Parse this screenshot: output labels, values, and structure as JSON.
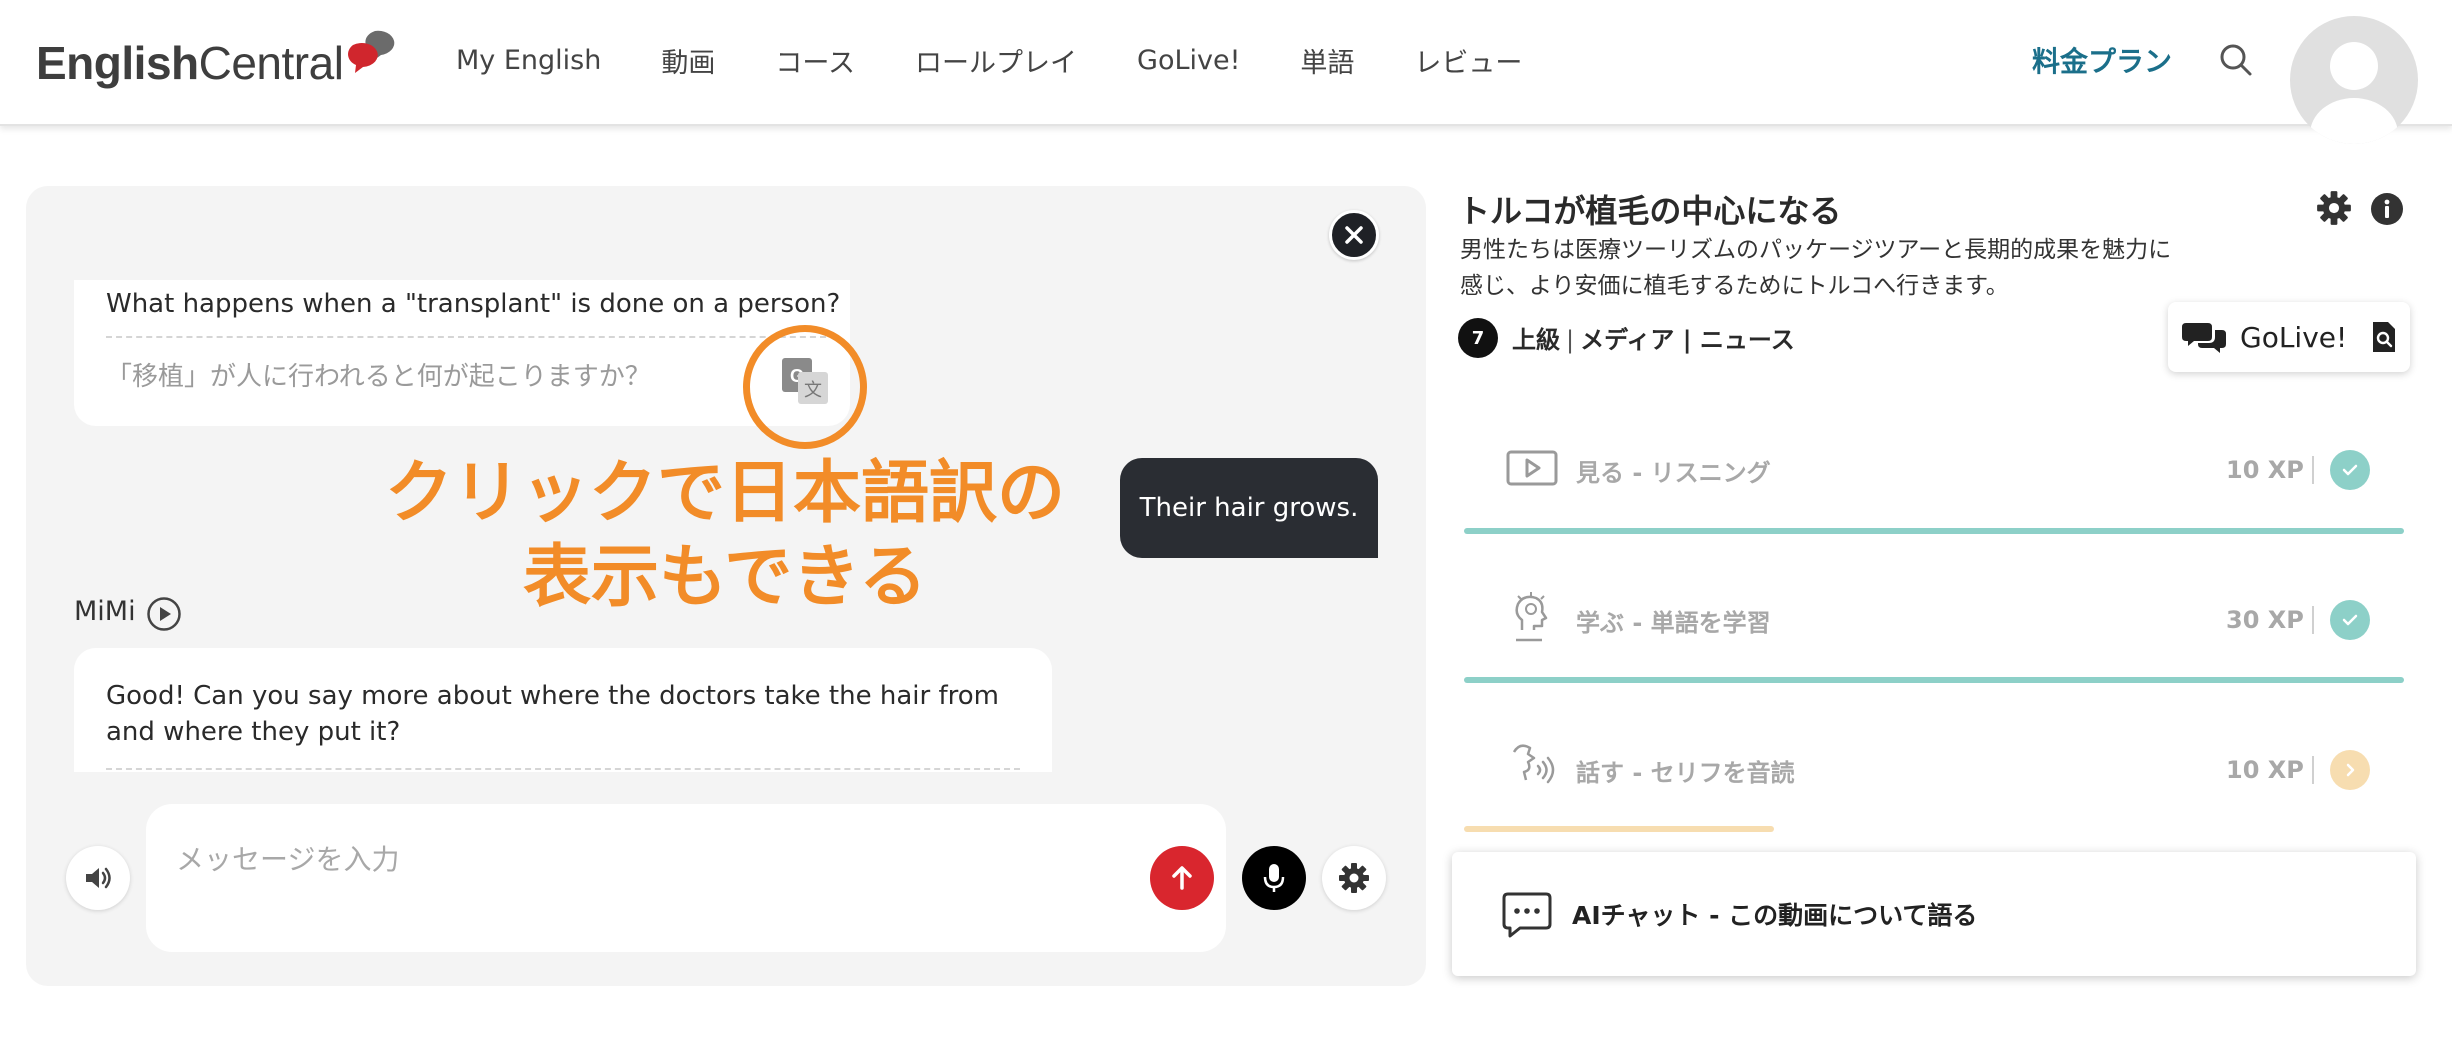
{
  "app": {
    "logo_bold": "English",
    "logo_light": "Central"
  },
  "nav": {
    "items": [
      "My English",
      "動画",
      "コース",
      "ロールプレイ",
      "GoLive!",
      "単語",
      "レビュー"
    ],
    "plan": "料金プラン"
  },
  "chat": {
    "message1_en": "What happens when a \"transplant\" is done on a person?",
    "message1_jp": "「移植」が人に行われると何が起こりますか？",
    "annotation_line1": "クリックで日本語訳の",
    "annotation_line2": "表示もできる",
    "user_reply": "Their hair grows.",
    "speaker": "MiMi",
    "message2_en": "Good! Can you say more about where the doctors take the hair from and where they put it?",
    "input_placeholder": "メッセージを入力"
  },
  "lesson": {
    "title": "トルコが植毛の中心になる",
    "description": "男性たちは医療ツーリズムのパッケージツアーと長期的成果を魅力に感じ、より安価に植毛するためにトルコへ行きます。",
    "level_number": "7",
    "level": "上級",
    "category": "メディア | ニュース",
    "golive": "GoLive!",
    "steps": [
      {
        "label": "見る - リスニング",
        "xp": "10 XP",
        "status": "complete",
        "progress": 1.0
      },
      {
        "label": "学ぶ - 単語を学習",
        "xp": "30 XP",
        "status": "complete",
        "progress": 1.0
      },
      {
        "label": "話す - セリフを音読",
        "xp": "10 XP",
        "status": "in-progress",
        "progress": 0.33
      }
    ],
    "aichat": "AIチャット - この動画について語る"
  },
  "colors": {
    "accent_orange": "#f28c28",
    "complete_teal": "#8dd0c8",
    "progress_peach": "#f7ddb0",
    "send_red": "#d9262e",
    "plan_blue": "#1b6f8a"
  }
}
